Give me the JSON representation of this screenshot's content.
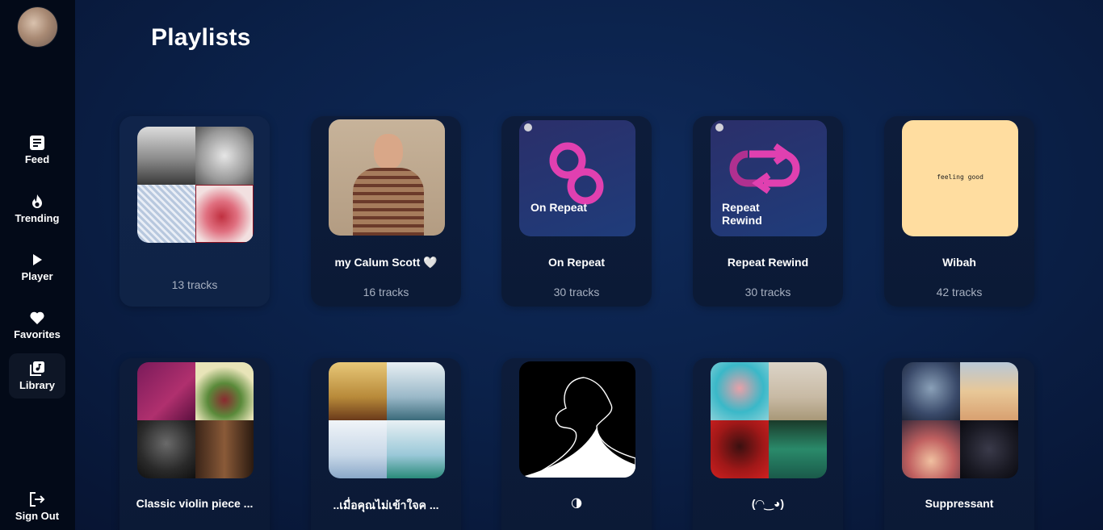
{
  "page": {
    "title": "Playlists"
  },
  "sidebar": {
    "items": [
      {
        "label": "Feed",
        "icon": "feed-icon"
      },
      {
        "label": "Trending",
        "icon": "flame-icon"
      },
      {
        "label": "Player",
        "icon": "play-icon"
      },
      {
        "label": "Favorites",
        "icon": "heart-icon"
      },
      {
        "label": "Library",
        "icon": "library-icon",
        "active": true
      }
    ],
    "sign_out": {
      "label": "Sign Out",
      "icon": "sign-out-icon"
    }
  },
  "playlists": [
    {
      "name": "",
      "tracks": "13 tracks"
    },
    {
      "name": "my Calum Scott 🤍",
      "tracks": "16 tracks"
    },
    {
      "name": "On Repeat",
      "tracks": "30 tracks",
      "cover_text": "On Repeat"
    },
    {
      "name": "Repeat Rewind",
      "tracks": "30 tracks",
      "cover_text": "Repeat Rewind"
    },
    {
      "name": "Wibah",
      "tracks": "42 tracks",
      "cover_text": "feeling good"
    },
    {
      "name": "Classic violin piece ...",
      "tracks": ""
    },
    {
      "name": "..เมื่อคุณไม่เข้าใจค ...",
      "tracks": ""
    },
    {
      "name": "🌗",
      "tracks": ""
    },
    {
      "name": "(◠‿◕)",
      "tracks": ""
    },
    {
      "name": "Suppressant",
      "tracks": ""
    }
  ],
  "colors": {
    "accent_pink": "#e040b0",
    "wibah_bg": "#ffdda0"
  }
}
